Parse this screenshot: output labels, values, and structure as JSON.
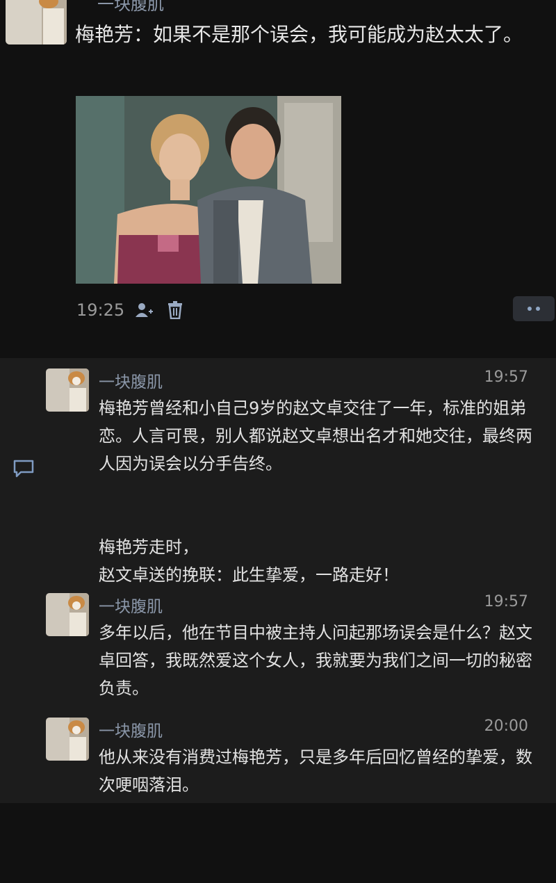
{
  "top_post": {
    "author": "一块腹肌",
    "text": "梅艳芳：如果不是那个误会，我可能成为赵太太了。",
    "time": "19:25",
    "icons": [
      "user-add-icon",
      "trash-icon",
      "more-icon"
    ]
  },
  "replies": [
    {
      "author": "一块腹肌",
      "time": "19:57",
      "para1": "梅艳芳曾经和小自己9岁的赵文卓交往了一年，标准的姐弟恋。人言可畏，别人都说赵文卓想出名才和她交往，最终两人因为误会以分手告终。",
      "para2": "梅艳芳走时，",
      "para3": "赵文卓送的挽联：此生挚爱，一路走好！"
    },
    {
      "author": "一块腹肌",
      "time": "19:57",
      "para1": "多年以后，他在节目中被主持人问起那场误会是什么？赵文卓回答，我既然爱这个女人，我就要为我们之间一切的秘密负责。"
    },
    {
      "author": "一块腹肌",
      "time": "20:00",
      "para1": "他从来没有消费过梅艳芳，只是多年后回忆曾经的挚爱，数次哽咽落泪。"
    }
  ],
  "colors": {
    "background": "#111111",
    "reply_background": "#1c1c1c",
    "author": "#8a96a8",
    "text": "#e2e2e2",
    "meta": "#9a9a9a"
  }
}
